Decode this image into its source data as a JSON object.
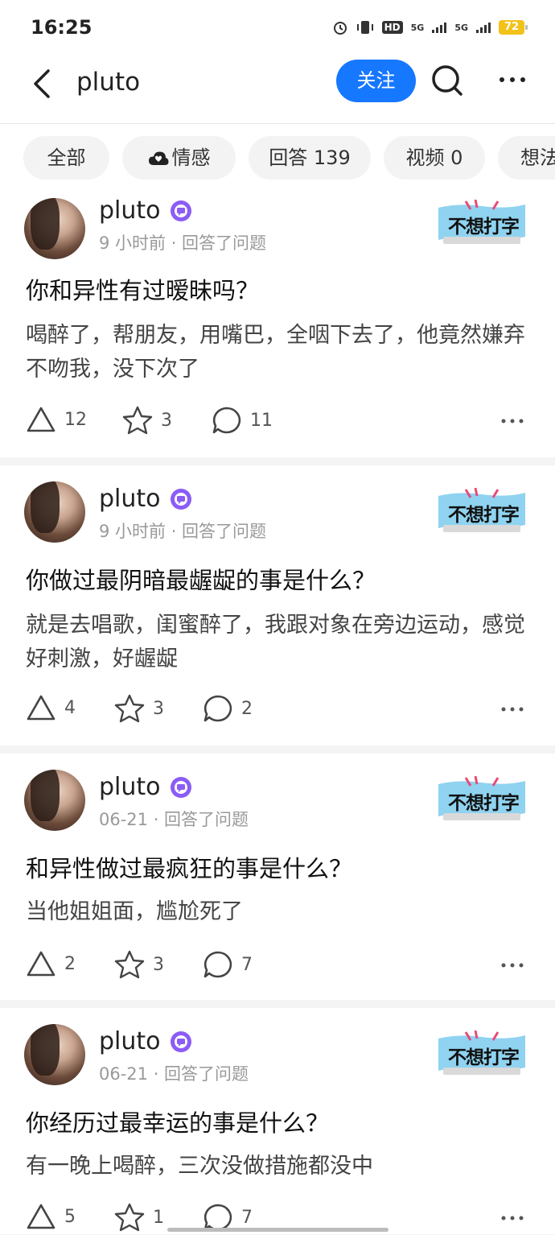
{
  "status_bar": {
    "time": "16:25",
    "battery": "72",
    "network": "5G"
  },
  "nav": {
    "title": "pluto",
    "follow_label": "关注"
  },
  "tabs": [
    {
      "label": "全部"
    },
    {
      "label": "情感"
    },
    {
      "label": "回答 139"
    },
    {
      "label": "视频 0"
    },
    {
      "label": "想法"
    }
  ],
  "posts": [
    {
      "author": "pluto",
      "meta": "9 小时前 · 回答了问题",
      "sticker": "不想打字",
      "question": "你和异性有过暧昧吗？",
      "answer": "喝醉了，帮朋友，用嘴巴，全咽下去了，他竟然嫌弃不吻我，没下次了",
      "likes": "12",
      "favorites": "3",
      "comments": "11"
    },
    {
      "author": "pluto",
      "meta": "9 小时前 · 回答了问题",
      "sticker": "不想打字",
      "question": "你做过最阴暗最龌龊的事是什么？",
      "answer": "就是去唱歌，闺蜜醉了，我跟对象在旁边运动，感觉好刺激，好龌龊",
      "likes": "4",
      "favorites": "3",
      "comments": "2"
    },
    {
      "author": "pluto",
      "meta": "06-21 · 回答了问题",
      "sticker": "不想打字",
      "question": "和异性做过最疯狂的事是什么？",
      "answer": "当他姐姐面，尴尬死了",
      "likes": "2",
      "favorites": "3",
      "comments": "7"
    },
    {
      "author": "pluto",
      "meta": "06-21 · 回答了问题",
      "sticker": "不想打字",
      "question": "你经历过最幸运的事是什么？",
      "answer": "有一晚上喝醉，三次没做措施都没中",
      "likes": "5",
      "favorites": "1",
      "comments": "7"
    }
  ],
  "colors": {
    "accent": "#1677ff",
    "badge": "#8b5cf6",
    "sticker_bg": "#8fd3f0",
    "battery": "#f3c21a"
  }
}
